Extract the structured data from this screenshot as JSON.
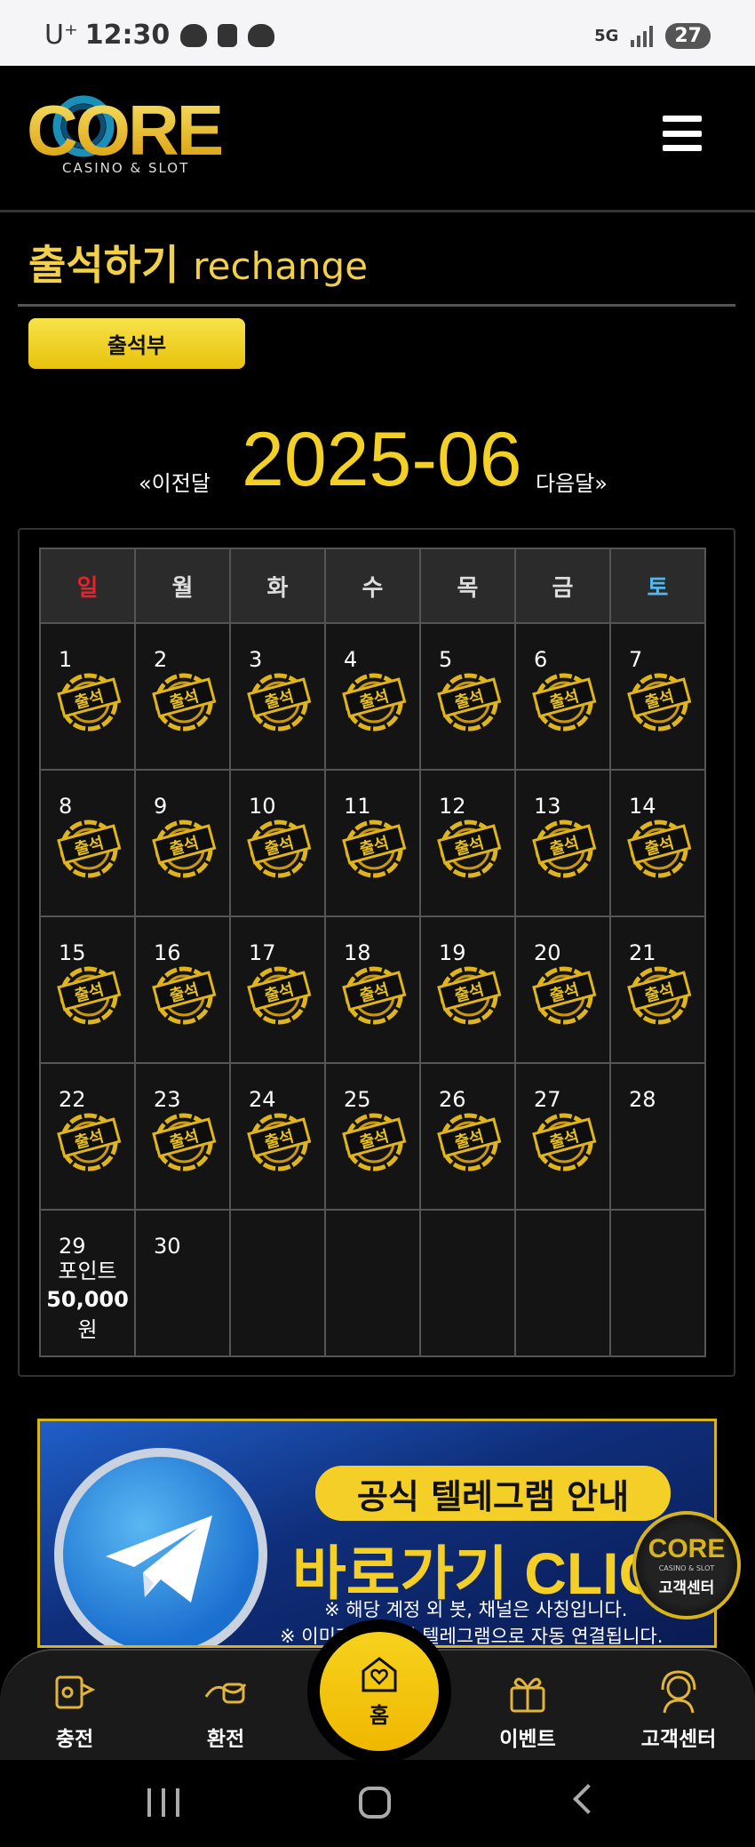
{
  "status_bar": {
    "carrier": "U⁺",
    "time": "12:30",
    "network": "5G",
    "battery": "27"
  },
  "header": {
    "logo_text": "CORE",
    "logo_subtext": "CASINO & SLOT"
  },
  "page": {
    "title": "출석하기",
    "title_sub": "rechange",
    "attendance_button": "출석부"
  },
  "month_nav": {
    "prev_label": "«이전달",
    "current": "2025-06",
    "next_label": "다음달»"
  },
  "calendar": {
    "weekdays": [
      "일",
      "월",
      "화",
      "수",
      "목",
      "금",
      "토"
    ],
    "stamp_text": "출석",
    "weeks": [
      [
        {
          "day": "1",
          "attended": true
        },
        {
          "day": "2",
          "attended": true
        },
        {
          "day": "3",
          "attended": true
        },
        {
          "day": "4",
          "attended": true
        },
        {
          "day": "5",
          "attended": true
        },
        {
          "day": "6",
          "attended": true
        },
        {
          "day": "7",
          "attended": true
        }
      ],
      [
        {
          "day": "8",
          "attended": true
        },
        {
          "day": "9",
          "attended": true
        },
        {
          "day": "10",
          "attended": true
        },
        {
          "day": "11",
          "attended": true
        },
        {
          "day": "12",
          "attended": true
        },
        {
          "day": "13",
          "attended": true
        },
        {
          "day": "14",
          "attended": true
        }
      ],
      [
        {
          "day": "15",
          "attended": true
        },
        {
          "day": "16",
          "attended": true
        },
        {
          "day": "17",
          "attended": true
        },
        {
          "day": "18",
          "attended": true
        },
        {
          "day": "19",
          "attended": true
        },
        {
          "day": "20",
          "attended": true
        },
        {
          "day": "21",
          "attended": true
        }
      ],
      [
        {
          "day": "22",
          "attended": true
        },
        {
          "day": "23",
          "attended": true
        },
        {
          "day": "24",
          "attended": true
        },
        {
          "day": "25",
          "attended": true
        },
        {
          "day": "26",
          "attended": true
        },
        {
          "day": "27",
          "attended": true
        },
        {
          "day": "28",
          "attended": false
        }
      ],
      [
        {
          "day": "29",
          "attended": false,
          "points_label": "포인트",
          "points_value": "50,000",
          "points_unit": "원"
        },
        {
          "day": "30",
          "attended": false
        },
        {
          "day": "",
          "attended": false
        },
        {
          "day": "",
          "attended": false
        },
        {
          "day": "",
          "attended": false
        },
        {
          "day": "",
          "attended": false
        },
        {
          "day": "",
          "attended": false
        }
      ]
    ]
  },
  "banner": {
    "pill_text": "공식 텔레그램 안내",
    "big_text": "바로가기 CLICK",
    "note1": "※ 해당 계정 외 봇, 채널은 사칭입니다.",
    "note2": "※ 이미지 클릭 시 텔레그램으로 자동 연결됩니다."
  },
  "customer_center_float": {
    "logo_text": "CORE",
    "logo_sub": "CASINO & SLOT",
    "label": "고객센터"
  },
  "bottom_nav": {
    "deposit": "충전",
    "withdraw": "환전",
    "home": "홈",
    "event": "이벤트",
    "support": "고객센터"
  },
  "colors": {
    "accent": "#f2d026",
    "sunday": "#e8202a",
    "saturday": "#53b8f0",
    "background": "#000000"
  }
}
